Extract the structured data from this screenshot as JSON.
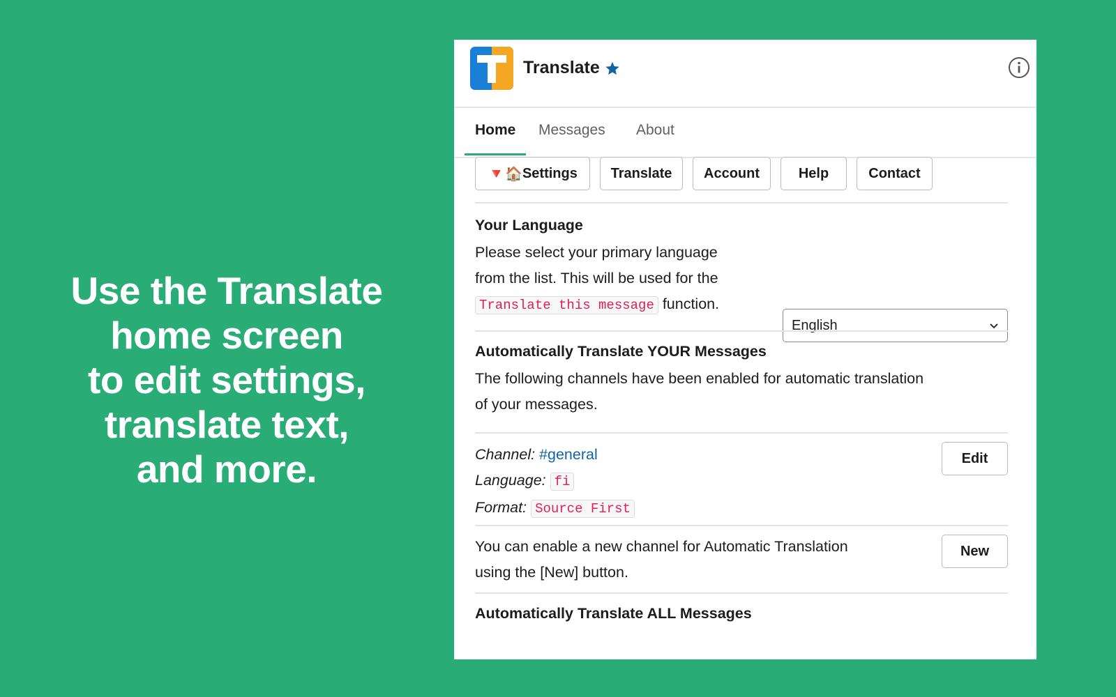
{
  "promo": {
    "lines": [
      "Use the Translate",
      "home screen",
      "to edit settings,",
      "translate text,",
      "and more."
    ]
  },
  "app": {
    "title": "Translate",
    "logo_letter": "T",
    "colors": {
      "accent": "#2aac76",
      "logo_blue": "#1a7fd6",
      "logo_orange": "#f5a623",
      "star": "#1264a3",
      "code_pink": "#e01e5a",
      "link": "#1264a3"
    }
  },
  "tabs": [
    {
      "label": "Home",
      "active": true
    },
    {
      "label": "Messages",
      "active": false
    },
    {
      "label": "About",
      "active": false
    }
  ],
  "buttons": {
    "settings_icons": "🔻🏠",
    "settings": "Settings",
    "translate": "Translate",
    "account": "Account",
    "help": "Help",
    "contact": "Contact",
    "edit": "Edit",
    "new": "New"
  },
  "your_language": {
    "title": "Your Language",
    "line1": "Please select your primary language",
    "line2": "from the list. This will be used for the",
    "code": "Translate this message",
    "line3_suffix": " function.",
    "select_value": "English"
  },
  "auto_your": {
    "title": "Automatically Translate YOUR Messages",
    "line1": "The following channels have been enabled for automatic translation",
    "line2": "of your messages.",
    "channel_label": "Channel:",
    "channel_value": "#general",
    "language_label": "Language:",
    "language_value": "fi",
    "format_label": "Format:",
    "format_value": "Source First",
    "new_line1": "You can enable a new channel for Automatic Translation",
    "new_line2": "using the [New] button."
  },
  "auto_all": {
    "title": "Automatically Translate ALL Messages"
  }
}
